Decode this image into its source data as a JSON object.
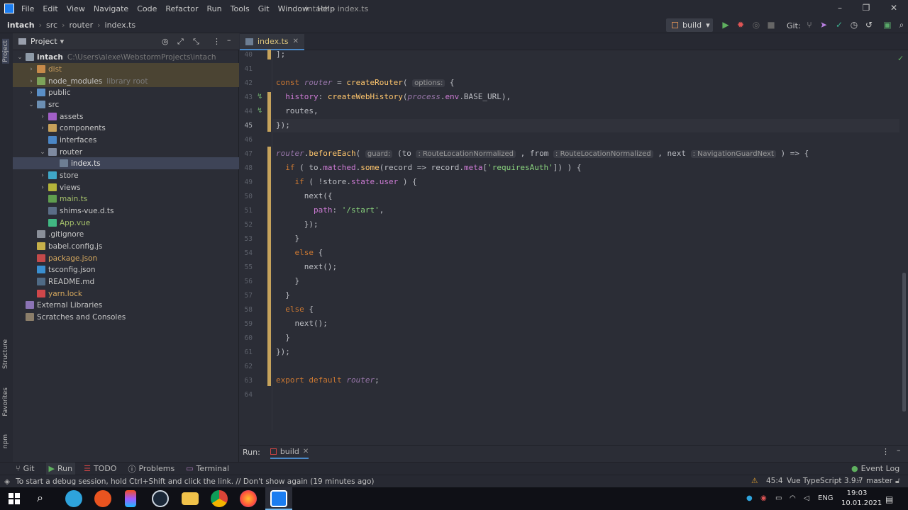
{
  "window": {
    "title": "intach - index.ts",
    "menu": [
      "File",
      "Edit",
      "View",
      "Navigate",
      "Code",
      "Refactor",
      "Run",
      "Tools",
      "Git",
      "Window",
      "Help"
    ]
  },
  "breadcrumb": [
    "intach",
    "src",
    "router",
    "index.ts"
  ],
  "toolbar": {
    "run_config": "build",
    "git_label": "Git:"
  },
  "project_panel": {
    "title": "Project",
    "tree": [
      {
        "label": "intach",
        "extra": "C:\\Users\\alexe\\WebstormProjects\\intach"
      },
      {
        "label": "dist"
      },
      {
        "label": "node_modules",
        "extra": "library root"
      },
      {
        "label": "public"
      },
      {
        "label": "src"
      },
      {
        "label": "assets"
      },
      {
        "label": "components"
      },
      {
        "label": "interfaces"
      },
      {
        "label": "router"
      },
      {
        "label": "index.ts"
      },
      {
        "label": "store"
      },
      {
        "label": "views"
      },
      {
        "label": "main.ts"
      },
      {
        "label": "shims-vue.d.ts"
      },
      {
        "label": "App.vue"
      },
      {
        "label": ".gitignore"
      },
      {
        "label": "babel.config.js"
      },
      {
        "label": "package.json"
      },
      {
        "label": "tsconfig.json"
      },
      {
        "label": "README.md"
      },
      {
        "label": "yarn.lock"
      },
      {
        "label": "External Libraries"
      },
      {
        "label": "Scratches and Consoles"
      }
    ]
  },
  "left_strip": [
    "Project",
    "Structure",
    "Favorites",
    "npm"
  ],
  "editor": {
    "tab": "index.ts",
    "line_numbers": [
      "40",
      "41",
      "42",
      "43",
      "44",
      "45",
      "46",
      "47",
      "48",
      "49",
      "50",
      "51",
      "52",
      "53",
      "54",
      "55",
      "56",
      "57",
      "58",
      "59",
      "60",
      "61",
      "62",
      "63",
      "64"
    ],
    "hints": {
      "options": "options:",
      "guard": "guard:",
      "to_type": ": RouteLocationNormalized",
      "from_type": ": RouteLocationNormalized",
      "next_type": ": NavigationGuardNext"
    }
  },
  "run_bar": {
    "label": "Run:",
    "tab": "build"
  },
  "bottom_tools": [
    "Git",
    "Run",
    "TODO",
    "Problems",
    "Terminal"
  ],
  "event_log": "Event Log",
  "status": {
    "message": "To start a debug session, hold Ctrl+Shift and click the link. // Don't show again (19 minutes ago)",
    "position": "45:4",
    "language": "Vue TypeScript 3.9.7",
    "branch": "master"
  },
  "taskbar": {
    "lang": "ENG",
    "time": "19:03",
    "date": "10.01.2021"
  }
}
